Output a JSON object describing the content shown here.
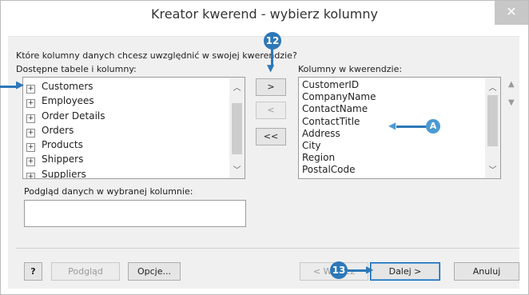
{
  "window": {
    "title": "Kreator kwerend - wybierz kolumny",
    "close_glyph": "✕"
  },
  "prompt": "Które kolumny danych chcesz uwzględnić w swojej kwerendzie?",
  "available": {
    "label": "Dostępne tabele i kolumny:",
    "items": [
      "Customers",
      "Employees",
      "Order Details",
      "Orders",
      "Products",
      "Shippers",
      "Suppliers"
    ]
  },
  "selected": {
    "label": "Kolumny w kwerendzie:",
    "items": [
      "CustomerID",
      "CompanyName",
      "ContactName",
      "ContactTitle",
      "Address",
      "City",
      "Region",
      "PostalCode"
    ]
  },
  "move_buttons": {
    "add": ">",
    "remove": "<",
    "remove_all": "<<"
  },
  "preview": {
    "label": "Podgląd danych w wybranej kolumnie:",
    "value": ""
  },
  "footer": {
    "help_glyph": "?",
    "preview_button": "Podgląd",
    "options_button": "Opcje...",
    "back_button": "< Wstecz",
    "next_button": "Dalej >",
    "cancel_button": "Anuluj"
  },
  "callouts": {
    "step12": "12",
    "step13": "13",
    "letter_a": "A"
  },
  "colors": {
    "callout": "#2d78b8",
    "callout_letter": "#4b9ad3",
    "close_button": "#c7c7c7"
  }
}
